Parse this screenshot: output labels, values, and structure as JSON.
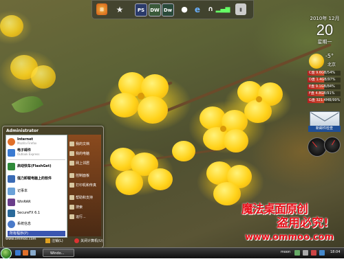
{
  "dock": {
    "ps_label": "PS",
    "dw_label": "DW",
    "dw2_label": "Dw"
  },
  "clock": {
    "date_line": "2010年 12月",
    "day": "20",
    "weekday": "星期一"
  },
  "weather": {
    "temp": "-5°",
    "city": "北京"
  },
  "meters": [
    {
      "label": "C盘 9.6GB/54%"
    },
    {
      "label": "D盘 1.4GB/97%"
    },
    {
      "label": "E盘 9.1GB/84%"
    },
    {
      "label": "F盘 4.8GB/91%"
    },
    {
      "label": "G盘 321.4MB/99%"
    }
  ],
  "mail_label": "新邮件检查",
  "start_menu": {
    "user": "Administrator",
    "left_items": [
      {
        "title": "Internet",
        "sub": "Mozilla Firefox",
        "color": "#e0702a"
      },
      {
        "title": "电子邮件",
        "sub": "Outlook Express",
        "color": "#3b7bd1"
      },
      {
        "title": "启动快车(FlashGet)",
        "sub": "",
        "color": "#2f8a3a"
      },
      {
        "title": "强力卸载电脑上的软件",
        "sub": "",
        "color": "#3a6bb5"
      },
      {
        "title": "记事本",
        "sub": "",
        "color": "#6aa2d8"
      },
      {
        "title": "WinRAR",
        "sub": "",
        "color": "#6a3d8a"
      },
      {
        "title": "SecureFX 6.1",
        "sub": "",
        "color": "#2a6a9a"
      },
      {
        "title": "系统信息",
        "sub": "",
        "color": "#4a7ac8"
      }
    ],
    "all_programs": "所有程序(P)",
    "right_items": [
      {
        "label": "我的文档"
      },
      {
        "label": "我的电脑"
      },
      {
        "label": "网上邻居"
      },
      {
        "label": "控制面板"
      },
      {
        "label": "打印机和传真"
      },
      {
        "label": "帮助和支持"
      },
      {
        "label": "搜索"
      },
      {
        "label": "运行..."
      }
    ],
    "logoff": "注销(L)",
    "shutdown": "关闭计算机(U)"
  },
  "watermark": {
    "line1": "魔法桌面原创",
    "line2": "盗用必究!",
    "line3": "www.ommoo.com"
  },
  "url_text": "www.ommoo.com",
  "taskbar": {
    "task_label": "Windo...",
    "tray_name": "moon",
    "time": "18:04"
  }
}
